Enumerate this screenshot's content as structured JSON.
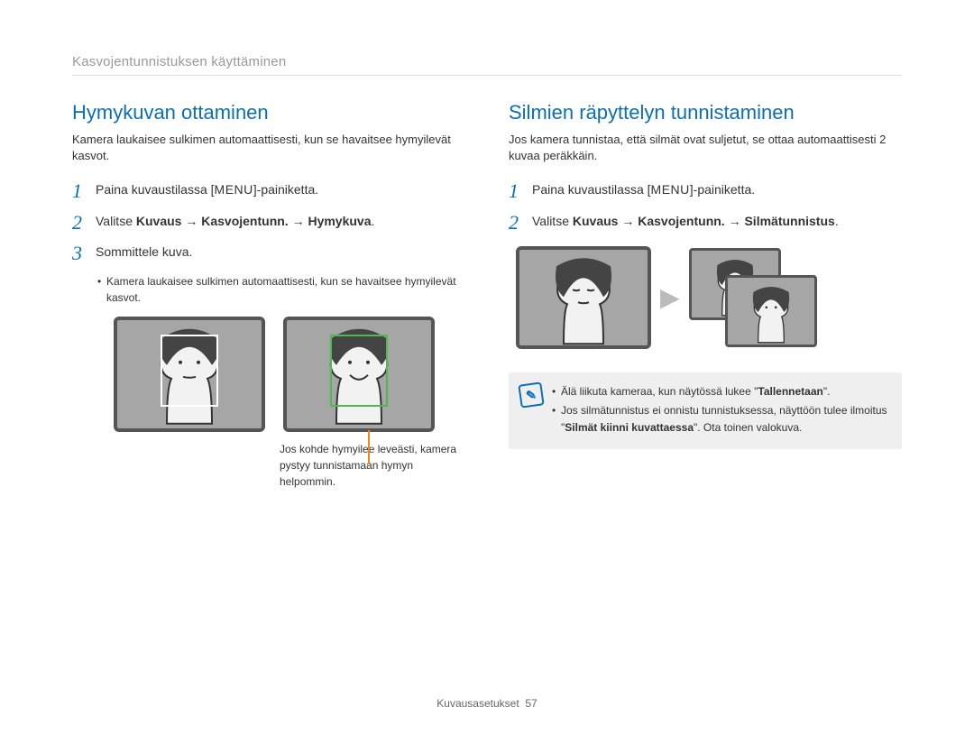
{
  "header": "Kasvojentunnistuksen käyttäminen",
  "left": {
    "title": "Hymykuvan ottaminen",
    "lead": "Kamera laukaisee sulkimen automaattisesti, kun se havaitsee hymyilevät kasvot.",
    "step1_pre": "Paina kuvaustilassa [",
    "step1_key": "MENU",
    "step1_post": "]-painiketta.",
    "step2_pre": "Valitse ",
    "step2_bold": "Kuvaus → Kasvojentunn. → Hymykuva",
    "step2_post": ".",
    "step3": "Sommittele kuva.",
    "bullet": "Kamera laukaisee sulkimen automaattisesti, kun se havaitsee hymyilevät kasvot.",
    "caption": "Jos kohde hymyilee leveästi, kamera pystyy tunnistamaan hymyn helpommin."
  },
  "right": {
    "title": "Silmien räpyttelyn tunnistaminen",
    "lead": "Jos kamera tunnistaa, että silmät ovat suljetut, se ottaa automaattisesti 2 kuvaa peräkkäin.",
    "step1_pre": "Paina kuvaustilassa [",
    "step1_key": "MENU",
    "step1_post": "]-painiketta.",
    "step2_pre": "Valitse ",
    "step2_bold": "Kuvaus → Kasvojentunn. → Silmätunnistus",
    "step2_post": ".",
    "note1_pre": "Älä liikuta kameraa, kun näytössä lukee \"",
    "note1_bold": "Tallennetaan",
    "note1_post": "\".",
    "note2_pre": "Jos silmätunnistus ei onnistu tunnistuksessa, näyttöön tulee ilmoitus \"",
    "note2_bold": "Silmät kiinni kuvattaessa",
    "note2_post": "\". Ota toinen valokuva."
  },
  "footer": {
    "section": "Kuvausasetukset",
    "page": "57"
  }
}
